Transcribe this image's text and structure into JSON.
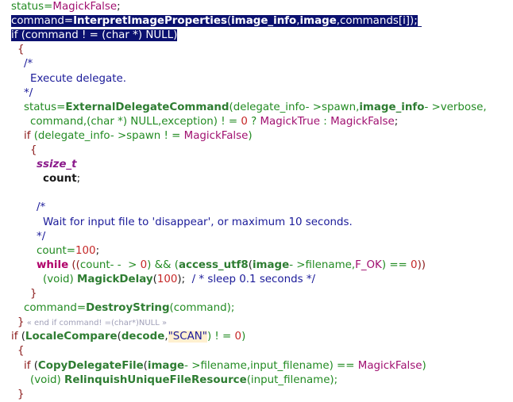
{
  "editor": {
    "lines": [
      {
        "indent": 14,
        "highlight": false,
        "tokens": [
          {
            "t": "status",
            "c": "k-id"
          },
          {
            "t": "=",
            "c": "k-id"
          },
          {
            "t": "MagickFalse",
            "c": "k-const"
          },
          {
            "t": ";",
            "c": "k-punc"
          }
        ]
      },
      {
        "indent": 14,
        "highlight": true,
        "tokens": [
          {
            "t": "command",
            "c": "k-id"
          },
          {
            "t": "=",
            "c": "k-id"
          },
          {
            "t": "InterpretImageProperties",
            "c": "k-bold"
          },
          {
            "t": "(",
            "c": "k-punc"
          },
          {
            "t": "image_info",
            "c": "k-bold"
          },
          {
            "t": ",",
            "c": "k-punc"
          },
          {
            "t": "image",
            "c": "k-bold"
          },
          {
            "t": ",commands[i]);",
            "c": "k-punc"
          }
        ]
      },
      {
        "indent": 14,
        "highlight": true,
        "tokens": [
          {
            "t": "if",
            "c": "k-kw"
          },
          {
            "t": " (command ! = (char *) NULL)",
            "c": "k-id"
          }
        ]
      },
      {
        "indent": 22,
        "highlight": false,
        "tokens": [
          {
            "t": "{",
            "c": "k-kw"
          }
        ]
      },
      {
        "indent": 30,
        "highlight": false,
        "tokens": [
          {
            "t": "/*",
            "c": "k-com"
          }
        ]
      },
      {
        "indent": 38,
        "highlight": false,
        "tokens": [
          {
            "t": "Execute delegate.",
            "c": "k-com"
          }
        ]
      },
      {
        "indent": 30,
        "highlight": false,
        "tokens": [
          {
            "t": "*/",
            "c": "k-com"
          }
        ]
      },
      {
        "indent": 30,
        "highlight": false,
        "tokens": [
          {
            "t": "status",
            "c": "k-id"
          },
          {
            "t": "=",
            "c": "k-id"
          },
          {
            "t": "ExternalDelegateCommand",
            "c": "k-call"
          },
          {
            "t": "(delegate_info- >spawn,",
            "c": "k-id"
          },
          {
            "t": "image_info",
            "c": "k-call"
          },
          {
            "t": "- >verbose,",
            "c": "k-id"
          }
        ]
      },
      {
        "indent": 38,
        "highlight": false,
        "tokens": [
          {
            "t": "command,(char *) NULL,exception) ! = ",
            "c": "k-id"
          },
          {
            "t": "0",
            "c": "k-num"
          },
          {
            "t": " ? ",
            "c": "k-id"
          },
          {
            "t": "MagickTrue",
            "c": "k-const"
          },
          {
            "t": " : ",
            "c": "k-id"
          },
          {
            "t": "MagickFalse",
            "c": "k-const"
          },
          {
            "t": ";",
            "c": "k-punc"
          }
        ]
      },
      {
        "indent": 30,
        "highlight": false,
        "tokens": [
          {
            "t": "if",
            "c": "k-kw"
          },
          {
            "t": " (delegate_info- >spawn ! = ",
            "c": "k-id"
          },
          {
            "t": "MagickFalse",
            "c": "k-const"
          },
          {
            "t": ")",
            "c": "k-id"
          }
        ]
      },
      {
        "indent": 38,
        "highlight": false,
        "tokens": [
          {
            "t": "{",
            "c": "k-kw"
          }
        ]
      },
      {
        "indent": 46,
        "highlight": false,
        "tokens": [
          {
            "t": "ssize_t",
            "c": "k-type"
          }
        ]
      },
      {
        "indent": 54,
        "highlight": false,
        "tokens": [
          {
            "t": "count",
            "c": "k-bold"
          },
          {
            "t": ";",
            "c": "k-punc"
          }
        ]
      },
      {
        "indent": 46,
        "highlight": false,
        "tokens": []
      },
      {
        "indent": 46,
        "highlight": false,
        "tokens": [
          {
            "t": "/*",
            "c": "k-com"
          }
        ]
      },
      {
        "indent": 54,
        "highlight": false,
        "tokens": [
          {
            "t": "Wait for input file to 'disappear', or maximum 10 seconds.",
            "c": "k-com"
          }
        ]
      },
      {
        "indent": 46,
        "highlight": false,
        "tokens": [
          {
            "t": "*/",
            "c": "k-com"
          }
        ]
      },
      {
        "indent": 46,
        "highlight": false,
        "tokens": [
          {
            "t": "count",
            "c": "k-id"
          },
          {
            "t": "=",
            "c": "k-id"
          },
          {
            "t": "100",
            "c": "k-num"
          },
          {
            "t": ";",
            "c": "k-punc"
          }
        ]
      },
      {
        "indent": 46,
        "highlight": false,
        "tokens": [
          {
            "t": "while",
            "c": "k-kwb"
          },
          {
            "t": " ((",
            "c": "k-kw"
          },
          {
            "t": "count- -  > ",
            "c": "k-id"
          },
          {
            "t": "0",
            "c": "k-num"
          },
          {
            "t": ") && (",
            "c": "k-id"
          },
          {
            "t": "access_utf8",
            "c": "k-call"
          },
          {
            "t": "(",
            "c": "k-punc"
          },
          {
            "t": "image",
            "c": "k-call"
          },
          {
            "t": "- >filename,",
            "c": "k-id"
          },
          {
            "t": "F_OK",
            "c": "k-const"
          },
          {
            "t": ") == ",
            "c": "k-id"
          },
          {
            "t": "0",
            "c": "k-num"
          },
          {
            "t": "))",
            "c": "k-kw"
          }
        ]
      },
      {
        "indent": 54,
        "highlight": false,
        "tokens": [
          {
            "t": "(void) ",
            "c": "k-id"
          },
          {
            "t": "MagickDelay",
            "c": "k-call"
          },
          {
            "t": "(",
            "c": "k-punc"
          },
          {
            "t": "100",
            "c": "k-num"
          },
          {
            "t": ");  ",
            "c": "k-punc"
          },
          {
            "t": "/ * sleep 0.1 seconds */",
            "c": "k-com"
          }
        ]
      },
      {
        "indent": 38,
        "highlight": false,
        "tokens": [
          {
            "t": "}",
            "c": "k-kw"
          }
        ]
      },
      {
        "indent": 30,
        "highlight": false,
        "tokens": [
          {
            "t": "command",
            "c": "k-id"
          },
          {
            "t": "=",
            "c": "k-id"
          },
          {
            "t": "DestroyString",
            "c": "k-call"
          },
          {
            "t": "(command);",
            "c": "k-id"
          }
        ]
      },
      {
        "indent": 22,
        "highlight": false,
        "tokens": [
          {
            "t": "}",
            "c": "k-kw"
          },
          {
            "t": " « end if command! =(char*)NULL »",
            "c": "k-fold"
          }
        ]
      },
      {
        "indent": 14,
        "highlight": false,
        "tokens": [
          {
            "t": "if",
            "c": "k-kw"
          },
          {
            "t": " (",
            "c": "k-plain"
          },
          {
            "t": "LocaleCompare",
            "c": "k-call"
          },
          {
            "t": "(",
            "c": "k-punc"
          },
          {
            "t": "decode",
            "c": "k-call"
          },
          {
            "t": ",",
            "c": "k-punc"
          },
          {
            "t": "\"SCAN\"",
            "c": "k-str-box"
          },
          {
            "t": ") ! = ",
            "c": "k-id"
          },
          {
            "t": "0",
            "c": "k-num"
          },
          {
            "t": ")",
            "c": "k-id"
          }
        ]
      },
      {
        "indent": 22,
        "highlight": false,
        "tokens": [
          {
            "t": "{",
            "c": "k-kw"
          }
        ]
      },
      {
        "indent": 30,
        "highlight": false,
        "tokens": [
          {
            "t": "if",
            "c": "k-kw"
          },
          {
            "t": " (",
            "c": "k-plain"
          },
          {
            "t": "CopyDelegateFile",
            "c": "k-call"
          },
          {
            "t": "(",
            "c": "k-punc"
          },
          {
            "t": "image",
            "c": "k-call"
          },
          {
            "t": "- >filename,input_filename) == ",
            "c": "k-id"
          },
          {
            "t": "MagickFalse",
            "c": "k-const"
          },
          {
            "t": ")",
            "c": "k-id"
          }
        ]
      },
      {
        "indent": 38,
        "highlight": false,
        "tokens": [
          {
            "t": "(void) ",
            "c": "k-id"
          },
          {
            "t": "RelinquishUniqueFileResource",
            "c": "k-call"
          },
          {
            "t": "(input_filename);",
            "c": "k-id"
          }
        ]
      },
      {
        "indent": 22,
        "highlight": false,
        "tokens": [
          {
            "t": "}",
            "c": "k-kw"
          }
        ]
      }
    ]
  }
}
